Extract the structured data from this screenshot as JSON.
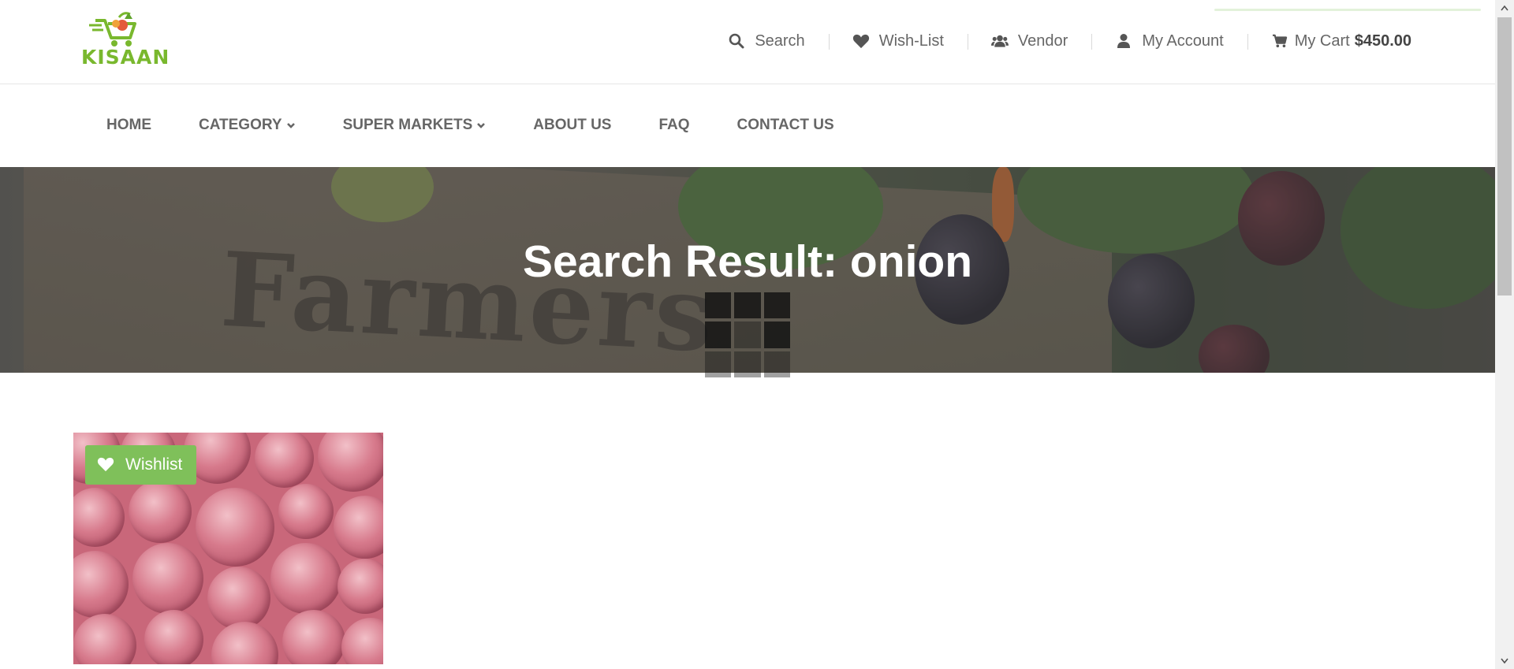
{
  "brand": {
    "name": "KISAAN",
    "color": "#79b82e"
  },
  "toplinks": {
    "search": "Search",
    "wishlist": "Wish-List",
    "vendor": "Vendor",
    "account": "My Account",
    "cart": "My Cart",
    "cart_amount": "$450.00"
  },
  "nav": {
    "items": [
      {
        "label": "HOME"
      },
      {
        "label": "CATEGORY"
      },
      {
        "label": "SUPER MARKETS"
      },
      {
        "label": "ABOUT US"
      },
      {
        "label": "FAQ"
      },
      {
        "label": "CONTACT US"
      }
    ]
  },
  "banner": {
    "title": "Search Result: onion",
    "background_word": "Farmers"
  },
  "product": {
    "wishlist_label": "Wishlist",
    "accent": "#7fc05a"
  },
  "icons": {
    "search": "search-icon",
    "wishlist": "heart-icon",
    "vendor": "users-icon",
    "account": "user-icon",
    "cart": "cart-icon",
    "dropdown": "chevron-down-icon"
  }
}
